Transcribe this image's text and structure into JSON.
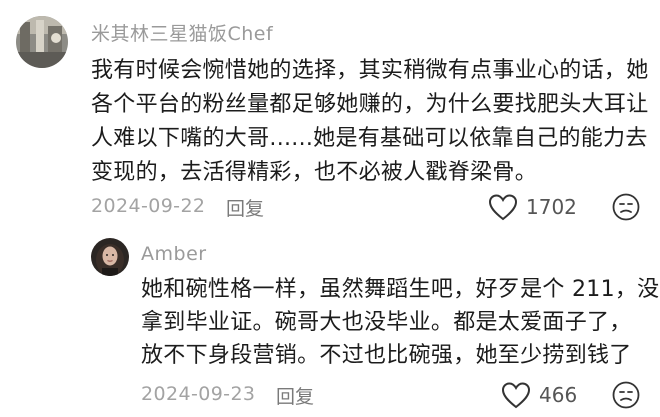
{
  "comments": [
    {
      "username": "米其林三星猫饭Chef",
      "lines": [
        "我有时候会惋惜她的选择，其实稍微有点事业心的话，她",
        "各个平台的粉丝量都足够她赚的，为什么要找肥头大耳让",
        "人难以下嘴的大哥......她是有基础可以依靠自己的能力去",
        "变现的，去活得精彩，也不必被人戳脊梁骨。"
      ],
      "date": "2024-09-22",
      "reply_label": "回复",
      "likes": "1702"
    },
    {
      "username": "Amber",
      "lines": [
        "她和碗性格一样，虽然舞蹈生吧，好歹是个 211，没",
        "拿到毕业证。碗哥大也没毕业。都是太爱面子了，",
        "放不下身段营销。不过也比碗强，她至少捞到钱了"
      ],
      "date": "2024-09-23",
      "reply_label": "回复",
      "likes": "466"
    }
  ],
  "icons": {
    "like": "heart-outline-icon",
    "dislike": "dislike-face-icon"
  },
  "colors": {
    "username": "#9a9a9a",
    "body_text": "#1c1c1c",
    "meta_text": "#a3a3a3",
    "icon_stroke": "#333333"
  }
}
